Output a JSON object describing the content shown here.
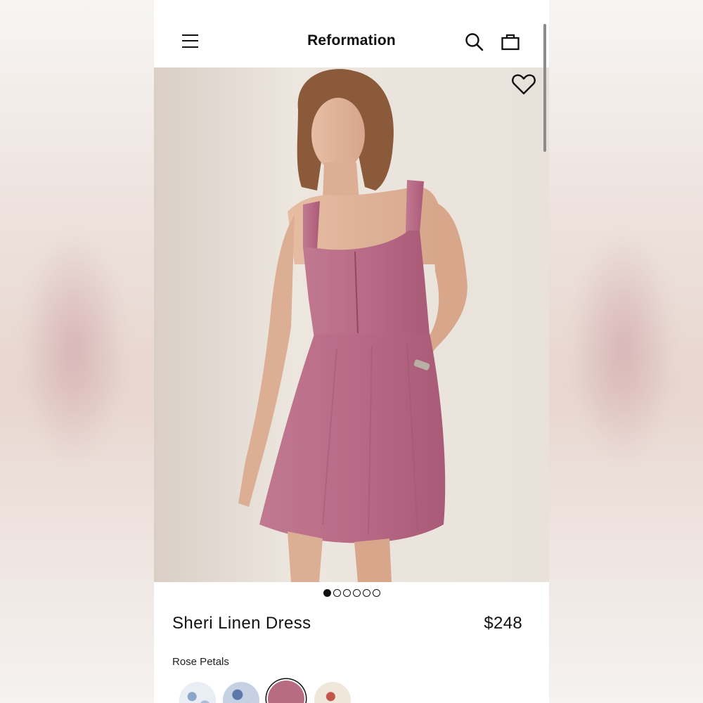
{
  "header": {
    "brand": "Reformation",
    "menu_icon": "hamburger-menu-icon",
    "search_icon": "search-icon",
    "bag_icon": "shopping-bag-icon"
  },
  "gallery": {
    "image_alt": "Model wearing Sheri Linen Dress in Rose Petals",
    "favorite_icon": "heart-icon",
    "total_images": 6,
    "active_index": 0
  },
  "product": {
    "name": "Sheri Linen Dress",
    "price": "$248",
    "color_name": "Rose Petals",
    "swatches": [
      {
        "name": "white-blue-floral",
        "color": "#e9eef5",
        "accent": "#8aa6c9"
      },
      {
        "name": "blue-floral",
        "color": "#c6d1e3",
        "accent": "#5c78a8"
      },
      {
        "name": "rose-petals",
        "color": "#b86c84",
        "accent": "#b86c84",
        "selected": true
      },
      {
        "name": "cream-floral",
        "color": "#efe7da",
        "accent": "#c1554c"
      }
    ]
  },
  "colors": {
    "dress": "#b96a86",
    "ink": "#111111"
  }
}
